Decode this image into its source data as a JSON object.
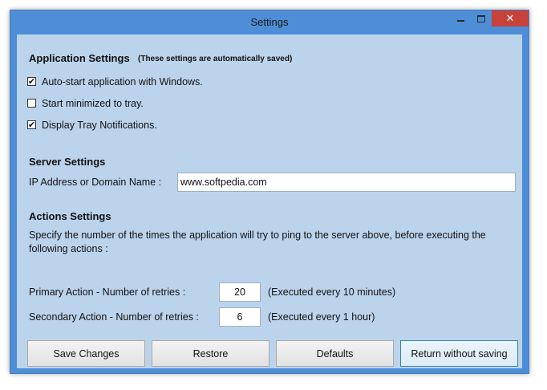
{
  "window": {
    "title": "Settings"
  },
  "app_settings": {
    "heading": "Application Settings",
    "note": "(These settings are automatically saved)",
    "options": [
      {
        "label": "Auto-start application with Windows.",
        "checked": true
      },
      {
        "label": "Start minimized to tray.",
        "checked": false
      },
      {
        "label": "Display Tray Notifications.",
        "checked": true
      }
    ]
  },
  "server_settings": {
    "heading": "Server Settings",
    "ip_label": "IP Address or Domain Name :",
    "ip_value": "www.softpedia.com"
  },
  "actions_settings": {
    "heading": "Actions Settings",
    "description_line1": "Specify the number of the times the application will try to ping to the server above, before executing the",
    "description_line2": "following actions :",
    "primary_label": "Primary Action - Number of retries :",
    "primary_value": "20",
    "primary_note": "(Executed every 10 minutes)",
    "secondary_label": "Secondary Action - Number of retries :",
    "secondary_value": "6",
    "secondary_note": "(Executed every 1 hour)"
  },
  "buttons": {
    "save": "Save Changes",
    "restore": "Restore",
    "defaults": "Defaults",
    "return": "Return without saving"
  },
  "checkmark": "✔",
  "close_glyph": "✕"
}
